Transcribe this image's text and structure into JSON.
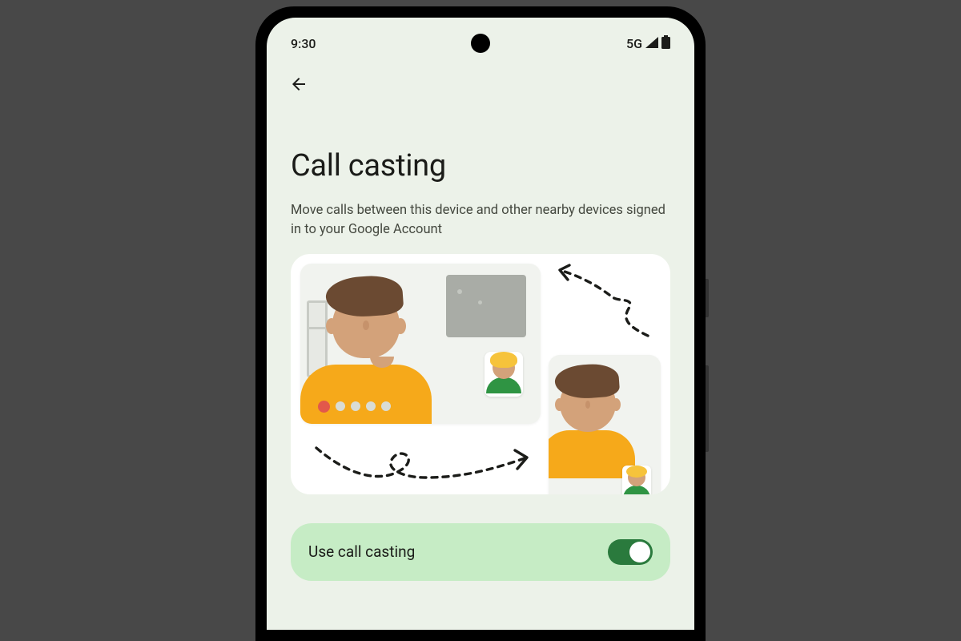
{
  "status_bar": {
    "time": "9:30",
    "network_label": "5G"
  },
  "page": {
    "title": "Call casting",
    "description": "Move calls between this device and other nearby devices signed in to your Google Account"
  },
  "toggle": {
    "label": "Use call casting",
    "state": "on"
  },
  "icons": {
    "back": "back-arrow-icon",
    "signal": "cell-signal-icon",
    "battery": "battery-full-icon"
  },
  "colors": {
    "screen_bg": "#ecf2e9",
    "toggle_card_bg": "#c6ecc5",
    "switch_on": "#2a7a3d",
    "accent_shirt": "#f6a91a",
    "accent_dot": "#e2584b"
  }
}
